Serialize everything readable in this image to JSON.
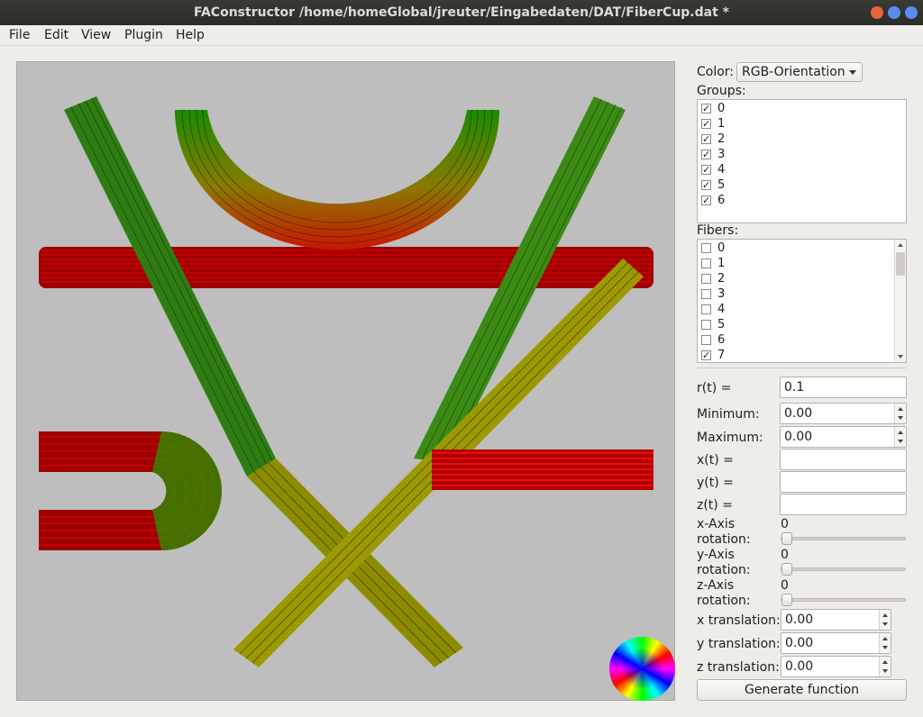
{
  "window": {
    "title": "FAConstructor /home/homeGlobal/jreuter/Eingabedaten/DAT/FiberCup.dat *",
    "btn_colors": [
      "#e8643c",
      "#5a8cf0",
      "#5a8cf0"
    ]
  },
  "menu": [
    "File",
    "Edit",
    "View",
    "Plugin",
    "Help"
  ],
  "color": {
    "label": "Color:",
    "value": "RGB-Orientation"
  },
  "groups": {
    "label": "Groups:",
    "items": [
      {
        "label": "0",
        "checked": true
      },
      {
        "label": "1",
        "checked": true
      },
      {
        "label": "2",
        "checked": true
      },
      {
        "label": "3",
        "checked": true
      },
      {
        "label": "4",
        "checked": true
      },
      {
        "label": "5",
        "checked": true
      },
      {
        "label": "6",
        "checked": true
      }
    ]
  },
  "fibers": {
    "label": "Fibers:",
    "items": [
      {
        "label": "0",
        "checked": false
      },
      {
        "label": "1",
        "checked": false
      },
      {
        "label": "2",
        "checked": false
      },
      {
        "label": "3",
        "checked": false
      },
      {
        "label": "4",
        "checked": false
      },
      {
        "label": "5",
        "checked": false
      },
      {
        "label": "6",
        "checked": false
      },
      {
        "label": "7",
        "checked": true
      }
    ]
  },
  "params": {
    "r_label": "r(t) =",
    "r_value": "0.1",
    "min_label": "Minimum:",
    "min_value": "0.00",
    "max_label": "Maximum:",
    "max_value": "0.00",
    "x_label": "x(t) =",
    "x_value": "",
    "y_label": "y(t) =",
    "y_value": "",
    "z_label": "z(t) =",
    "z_value": ""
  },
  "rotation": {
    "x_label1": "x-Axis",
    "x_label2": "rotation:",
    "x_value": "0",
    "y_label1": "y-Axis",
    "y_label2": "rotation:",
    "y_value": "0",
    "z_label1": "z-Axis",
    "z_label2": "rotation:",
    "z_value": "0"
  },
  "translation": {
    "x_label": "x translation:",
    "x_value": "0.00",
    "y_label": "y translation:",
    "y_value": "0.00",
    "z_label": "z translation:",
    "z_value": "0.00"
  },
  "generate_label": "Generate function"
}
